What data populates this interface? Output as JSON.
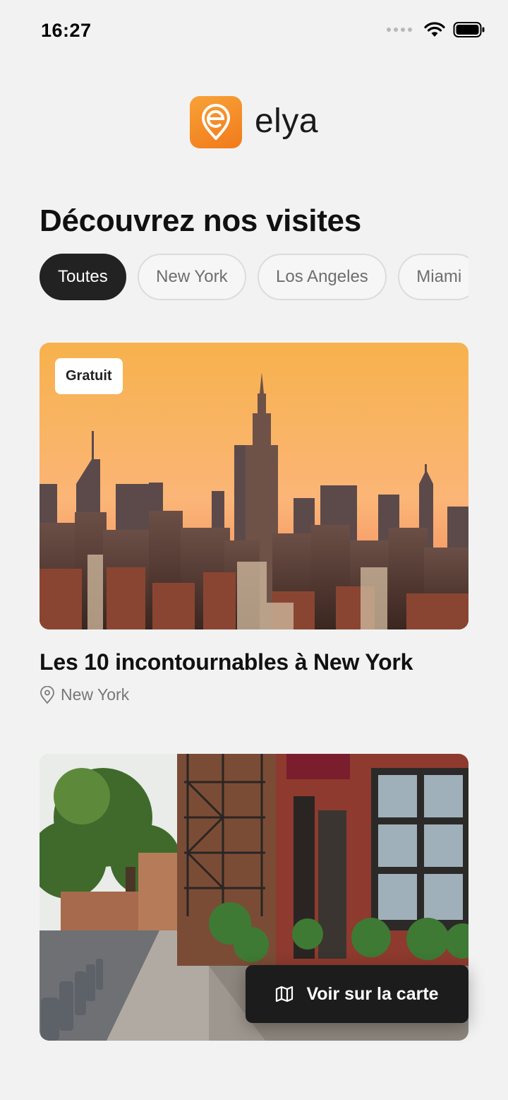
{
  "status_bar": {
    "time": "16:27"
  },
  "brand": {
    "name": "elya",
    "accent": "#F58A26"
  },
  "section_title": "Découvrez nos visites",
  "filters": [
    {
      "label": "Toutes",
      "active": true
    },
    {
      "label": "New York",
      "active": false
    },
    {
      "label": "Los Angeles",
      "active": false
    },
    {
      "label": "Miami",
      "active": false
    }
  ],
  "tours": [
    {
      "badge": "Gratuit",
      "title": "Les 10 incontournables à New York",
      "location": "New York"
    }
  ],
  "map_button": {
    "label": "Voir sur la carte",
    "icon": "map-icon"
  }
}
